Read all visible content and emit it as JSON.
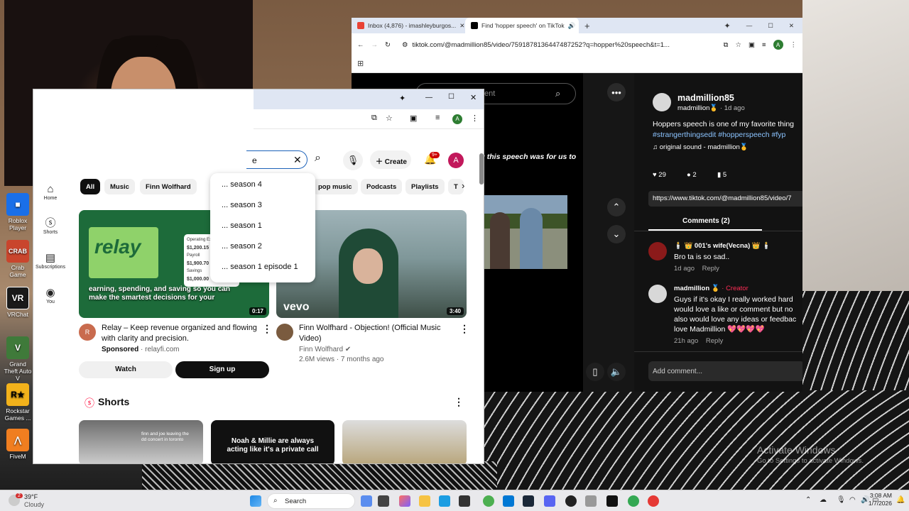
{
  "desktop": {
    "icons": [
      {
        "label": "Roblox Player",
        "icon": "roblox-icon",
        "color": "#1a6fe8"
      },
      {
        "label": "Crab Game",
        "icon": "crab-game-icon",
        "color": "#c9452d"
      },
      {
        "label": "VRChat",
        "icon": "vrchat-icon",
        "color": "#1a1a1a"
      },
      {
        "label": "Grand Theft Auto V",
        "icon": "gta-icon",
        "color": "#3f7a3a"
      },
      {
        "label": "Rockstar Games ...",
        "icon": "rockstar-icon",
        "color": "#f2b21b"
      },
      {
        "label": "FiveM",
        "icon": "fivem-icon",
        "color": "#f07e20"
      }
    ],
    "activate": {
      "line1": "Activate Windows",
      "line2": "Go to Settings to activate Windows."
    }
  },
  "tiktok_window": {
    "tabs": [
      {
        "label": "Inbox (4,876) - imashleyburgos...",
        "icon": "gmail-icon"
      },
      {
        "label": "Find 'hopper speech' on TikTok",
        "icon": "tiktok-icon"
      }
    ],
    "new_tab": "+",
    "url": "tiktok.com/@madmillion85/video/7591878136447487252?q=hopper%20speech&t=1...",
    "search_placeholder": "ent",
    "video_caption_overlay": "ng this speech was for us to",
    "author": "madmillion85",
    "author_sub": "madmillion",
    "author_sub_emoji": "🥇",
    "posted": "· 1d ago",
    "caption": "Hoppers speech is one of my favorite thing",
    "hashtags": "#strangerthingsedit #hopperspeech #fyp",
    "sound": "original sound - madmillion",
    "sound_emoji": "🥇",
    "likes": "29",
    "comments_count": "2",
    "saves": "5",
    "share_url": "https://www.tiktok.com/@madmillion85/video/7",
    "comments_tab": "Comments (2)",
    "comments": [
      {
        "author": "🕯️ 👑 001's wife(Vecna) 👑 🕯️",
        "text": "Bro ta is so sad..",
        "time": "1d ago",
        "reply": "Reply",
        "creator": ""
      },
      {
        "author": "madmillion 🥇",
        "creator": "· Creator",
        "text": "Guys if it's okay I really worked hard would love a like or comment but no also would love any ideas or feedbac love Madmillion 💖💖💖💖",
        "time": "21h ago",
        "reply": "Reply"
      }
    ],
    "add_comment": "Add comment..."
  },
  "youtube_window": {
    "search_value": "e",
    "create_label": "Create",
    "notif_count": "9+",
    "avatar_letter": "A",
    "suggestions": [
      "... season 4",
      "... season 3",
      "... season 1",
      "... season 2",
      "... season 1 episode 1"
    ],
    "chips": [
      "All",
      "Music",
      "Finn Wolfhard",
      "pop music",
      "Podcasts",
      "Playlists",
      "T"
    ],
    "sidebar": [
      {
        "label": "Home",
        "icon": "home-icon",
        "glyph": "⌂"
      },
      {
        "label": "Shorts",
        "icon": "shorts-icon",
        "glyph": "ⓢ"
      },
      {
        "label": "Subscriptions",
        "icon": "subscriptions-icon",
        "glyph": "▤"
      },
      {
        "label": "You",
        "icon": "you-icon",
        "glyph": "◉"
      }
    ],
    "ad": {
      "thumb_text": "earning, spending, and saving so you can make the smartest decisions for your",
      "brand_word": "relay",
      "duration": "0:17",
      "title": "Relay – Keep revenue organized and flowing with clarity and precision.",
      "sponsored": "Sponsored",
      "domain": "· relayfi.com",
      "watch": "Watch",
      "signup": "Sign up",
      "card_labels": [
        "Operating Expen",
        "$1,200.15",
        "Payroll",
        "$1,900.70",
        "Savings",
        "$1,000.00"
      ]
    },
    "video": {
      "title": "Finn Wolfhard - Objection! (Official Music Video)",
      "channel": "Finn Wolfhard",
      "views": "2.6M views · 7 months ago",
      "duration": "3:40",
      "watermark": "vevo"
    },
    "shorts_title": "Shorts",
    "shorts": [
      {
        "text": "finn and joe leaving the dd concert in toronto"
      },
      {
        "text": "Noah & Millie are always acting like it's a private call"
      },
      {
        "text": ""
      }
    ]
  },
  "taskbar": {
    "weather_temp": "39°F",
    "weather_desc": "Cloudy",
    "weather_badge": "2",
    "search_label": "Search",
    "time": "3:08 AM",
    "date": "1/7/2026"
  }
}
